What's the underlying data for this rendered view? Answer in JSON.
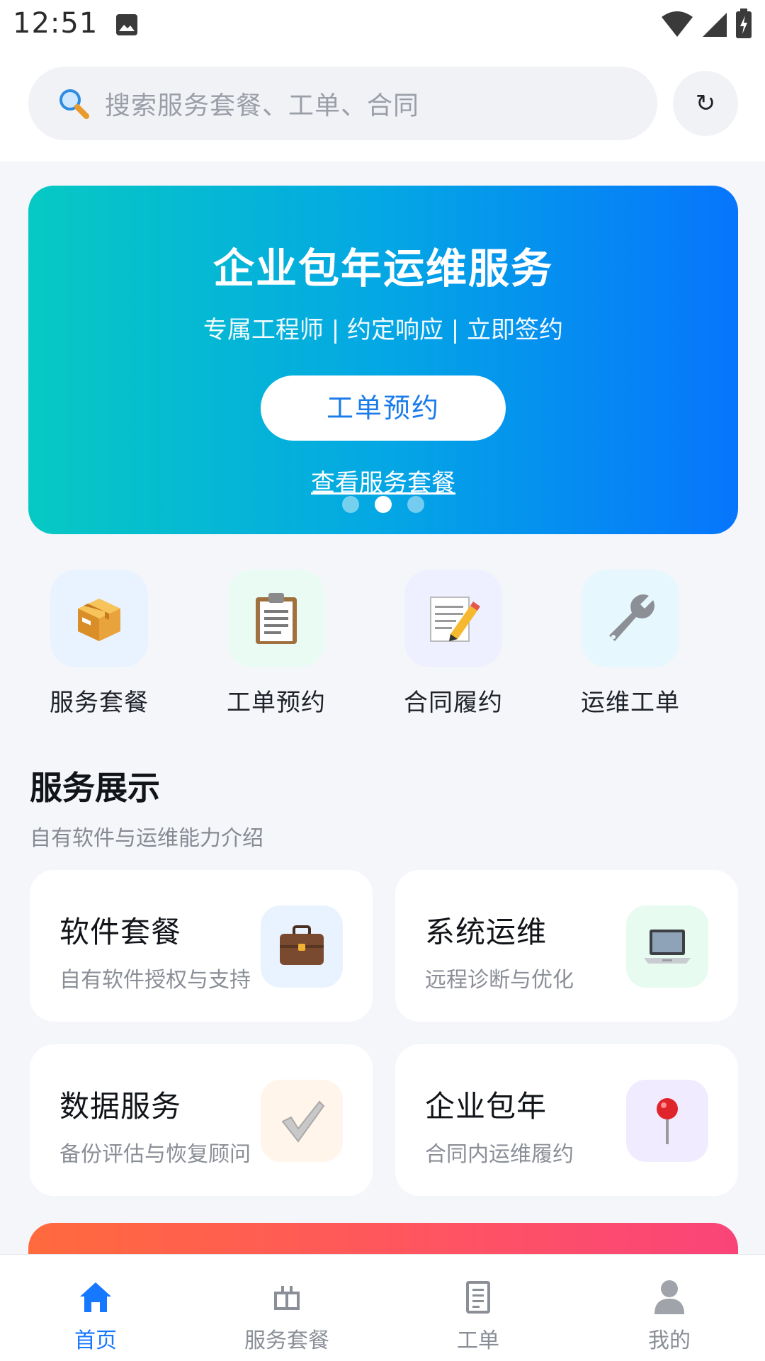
{
  "status_bar": {
    "time": "12:51"
  },
  "search": {
    "placeholder": "搜索服务套餐、工单、合同",
    "refresh_glyph": "↻"
  },
  "banner": {
    "title": "企业包年运维服务",
    "subtitle": "专属工程师 | 约定响应 | 立即签约",
    "cta_label": "工单预约",
    "link_label": "查看服务套餐",
    "slide_count": 3,
    "active_slide": 2
  },
  "quick_actions": [
    {
      "label": "服务套餐",
      "icon": "package-icon",
      "bg": "#E9F3FF"
    },
    {
      "label": "工单预约",
      "icon": "clipboard-icon",
      "bg": "#E9FBF3"
    },
    {
      "label": "合同履约",
      "icon": "memo-pencil-icon",
      "bg": "#EEF0FF"
    },
    {
      "label": "运维工单",
      "icon": "wrench-icon",
      "bg": "#E6F8FD"
    }
  ],
  "section": {
    "title": "服务展示",
    "subtitle": "自有软件与运维能力介绍"
  },
  "service_cards": [
    {
      "title": "软件套餐",
      "desc": "自有软件授权与支持",
      "icon": "briefcase-icon",
      "bg": "#E9F3FF"
    },
    {
      "title": "系统运维",
      "desc": "远程诊断与优化",
      "icon": "laptop-icon",
      "bg": "#E7FBF1"
    },
    {
      "title": "数据服务",
      "desc": "备份评估与恢复顾问",
      "icon": "check-mark-icon",
      "bg": "#FFF5EA"
    },
    {
      "title": "企业包年",
      "desc": "合同内运维履约",
      "icon": "pushpin-icon",
      "bg": "#F0EBFF"
    }
  ],
  "bottom_nav": [
    {
      "label": "首页",
      "icon": "home-icon",
      "active": true
    },
    {
      "label": "服务套餐",
      "icon": "package-shelf-icon",
      "active": false
    },
    {
      "label": "工单",
      "icon": "document-icon",
      "active": false
    },
    {
      "label": "我的",
      "icon": "user-icon",
      "active": false
    }
  ],
  "colors": {
    "primary": "#1677FF",
    "banner_start": "#06C9C3",
    "banner_end": "#0675FC",
    "inactive_nav": "#8A8E96"
  }
}
